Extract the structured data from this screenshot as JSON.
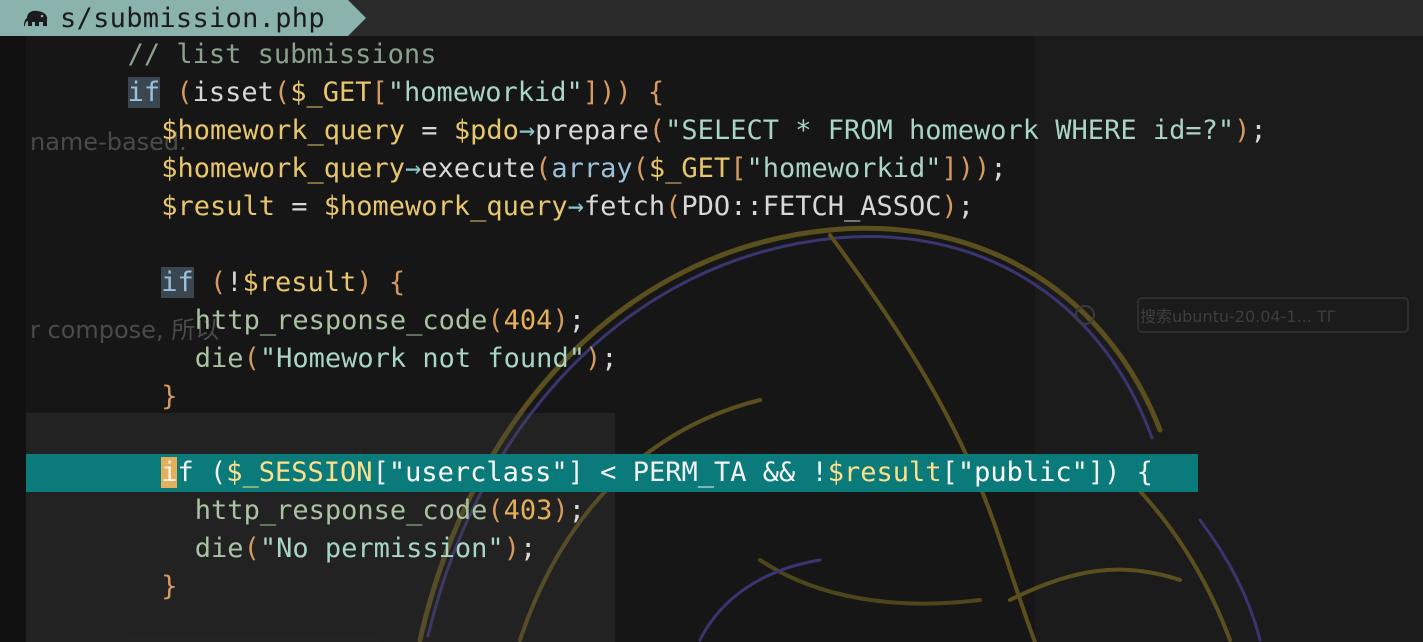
{
  "tab": {
    "icon": "php-elephant-icon",
    "filename": "s/submission.php",
    "color": "#8bb3ad"
  },
  "background_ghost": {
    "text_left_1": "name-based.",
    "text_left_2": "r compose, 所以",
    "search_placeholder": "搜索ubuntu-20.04-1... ТГ"
  },
  "editor": {
    "current_line_color": "#0b7a7a",
    "lines": [
      {
        "indent": "  ",
        "tokens": [
          {
            "t": "// list submissions",
            "c": "comment"
          }
        ]
      },
      {
        "indent": "  ",
        "tokens": [
          {
            "t": "if",
            "c": "kw-hl"
          },
          {
            "t": " ",
            "c": "op"
          },
          {
            "t": "(",
            "c": "paren"
          },
          {
            "t": "isset",
            "c": "fn"
          },
          {
            "t": "(",
            "c": "paren"
          },
          {
            "t": "$_GET",
            "c": "var"
          },
          {
            "t": "[",
            "c": "bracket"
          },
          {
            "t": "\"homeworkid\"",
            "c": "str"
          },
          {
            "t": "]",
            "c": "bracket"
          },
          {
            "t": "))",
            "c": "paren"
          },
          {
            "t": " ",
            "c": "op"
          },
          {
            "t": "{",
            "c": "paren"
          }
        ]
      },
      {
        "indent": "    ",
        "tokens": [
          {
            "t": "$homework_query",
            "c": "var"
          },
          {
            "t": " = ",
            "c": "op"
          },
          {
            "t": "$pdo",
            "c": "var"
          },
          {
            "t": "→",
            "c": "arrow"
          },
          {
            "t": "prepare",
            "c": "fn"
          },
          {
            "t": "(",
            "c": "paren"
          },
          {
            "t": "\"SELECT * FROM homework WHERE id=?\"",
            "c": "str"
          },
          {
            "t": ")",
            "c": "paren"
          },
          {
            "t": ";",
            "c": "op"
          }
        ]
      },
      {
        "indent": "    ",
        "tokens": [
          {
            "t": "$homework_query",
            "c": "var"
          },
          {
            "t": "→",
            "c": "arrow"
          },
          {
            "t": "execute",
            "c": "fn"
          },
          {
            "t": "(",
            "c": "paren"
          },
          {
            "t": "array",
            "c": "kw"
          },
          {
            "t": "(",
            "c": "paren"
          },
          {
            "t": "$_GET",
            "c": "var"
          },
          {
            "t": "[",
            "c": "bracket"
          },
          {
            "t": "\"homeworkid\"",
            "c": "str"
          },
          {
            "t": "]",
            "c": "bracket"
          },
          {
            "t": "))",
            "c": "paren"
          },
          {
            "t": ";",
            "c": "op"
          }
        ]
      },
      {
        "indent": "    ",
        "tokens": [
          {
            "t": "$result",
            "c": "var"
          },
          {
            "t": " = ",
            "c": "op"
          },
          {
            "t": "$homework_query",
            "c": "var"
          },
          {
            "t": "→",
            "c": "arrow"
          },
          {
            "t": "fetch",
            "c": "fn"
          },
          {
            "t": "(",
            "c": "paren"
          },
          {
            "t": "PDO::FETCH_ASSOC",
            "c": "const"
          },
          {
            "t": ")",
            "c": "paren"
          },
          {
            "t": ";",
            "c": "op"
          }
        ]
      },
      {
        "indent": "",
        "tokens": []
      },
      {
        "indent": "    ",
        "tokens": [
          {
            "t": "if",
            "c": "kw-hl"
          },
          {
            "t": " ",
            "c": "op"
          },
          {
            "t": "(",
            "c": "paren"
          },
          {
            "t": "!",
            "c": "op"
          },
          {
            "t": "$result",
            "c": "var"
          },
          {
            "t": ")",
            "c": "paren"
          },
          {
            "t": " ",
            "c": "op"
          },
          {
            "t": "{",
            "c": "paren"
          }
        ]
      },
      {
        "indent": "      ",
        "tokens": [
          {
            "t": "http_response_code",
            "c": "die"
          },
          {
            "t": "(",
            "c": "paren"
          },
          {
            "t": "404",
            "c": "num"
          },
          {
            "t": ")",
            "c": "paren"
          },
          {
            "t": ";",
            "c": "op"
          }
        ]
      },
      {
        "indent": "      ",
        "tokens": [
          {
            "t": "die",
            "c": "die"
          },
          {
            "t": "(",
            "c": "paren"
          },
          {
            "t": "\"Homework not found\"",
            "c": "str"
          },
          {
            "t": ")",
            "c": "paren"
          },
          {
            "t": ";",
            "c": "op"
          }
        ]
      },
      {
        "indent": "    ",
        "tokens": [
          {
            "t": "}",
            "c": "paren"
          }
        ]
      },
      {
        "indent": "",
        "tokens": []
      },
      {
        "indent": "    ",
        "current": true,
        "tokens": [
          {
            "t": "i",
            "c": "cursor"
          },
          {
            "t": "f",
            "c": "op"
          },
          {
            "t": " ",
            "c": "op"
          },
          {
            "t": "(",
            "c": "op"
          },
          {
            "t": "$_SESSION",
            "c": "var"
          },
          {
            "t": "[",
            "c": "op"
          },
          {
            "t": "\"userclass\"",
            "c": "str"
          },
          {
            "t": "]",
            "c": "op"
          },
          {
            "t": " < ",
            "c": "op"
          },
          {
            "t": "PERM_TA",
            "c": "const"
          },
          {
            "t": " && ",
            "c": "op"
          },
          {
            "t": "!",
            "c": "op"
          },
          {
            "t": "$result",
            "c": "var"
          },
          {
            "t": "[",
            "c": "op"
          },
          {
            "t": "\"public\"",
            "c": "str"
          },
          {
            "t": "])",
            "c": "op"
          },
          {
            "t": " ",
            "c": "op"
          },
          {
            "t": "{",
            "c": "op"
          }
        ]
      },
      {
        "indent": "      ",
        "tokens": [
          {
            "t": "http_response_code",
            "c": "die"
          },
          {
            "t": "(",
            "c": "paren"
          },
          {
            "t": "403",
            "c": "num"
          },
          {
            "t": ")",
            "c": "paren"
          },
          {
            "t": ";",
            "c": "op"
          }
        ]
      },
      {
        "indent": "      ",
        "tokens": [
          {
            "t": "die",
            "c": "die"
          },
          {
            "t": "(",
            "c": "paren"
          },
          {
            "t": "\"No permission\"",
            "c": "str"
          },
          {
            "t": ")",
            "c": "paren"
          },
          {
            "t": ";",
            "c": "op"
          }
        ]
      },
      {
        "indent": "    ",
        "tokens": [
          {
            "t": "}",
            "c": "paren"
          }
        ]
      }
    ]
  }
}
